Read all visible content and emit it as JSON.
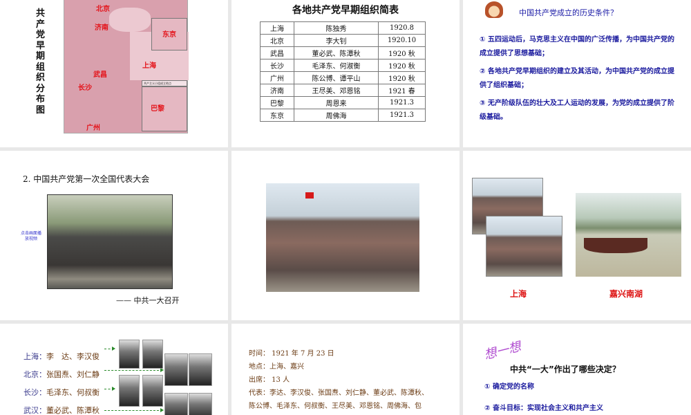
{
  "slide1": {
    "title": "共产党早期组织分布图",
    "map_labels": [
      "北京",
      "济南",
      "东京",
      "上海",
      "武昌",
      "长沙",
      "巴黎",
      "广州"
    ],
    "legend": "共产主义小组成立地点"
  },
  "slide2": {
    "title": "各地共产党早期组织简表",
    "rows": [
      [
        "上海",
        "陈独秀",
        "1920.8"
      ],
      [
        "北京",
        "李大钊",
        "1920.10"
      ],
      [
        "武昌",
        "董必武、陈潭秋",
        "1920 秋"
      ],
      [
        "长沙",
        "毛泽东、何淑衡",
        "1920 秋"
      ],
      [
        "广州",
        "陈公博、谭平山",
        "1920 秋"
      ],
      [
        "济南",
        "王尽美、邓恩铭",
        "1921 春"
      ],
      [
        "巴黎",
        "周恩来",
        "1921.3"
      ],
      [
        "东京",
        "周佛海",
        "1921.3"
      ]
    ]
  },
  "slide3": {
    "question": "中国共产党成立的历史条件？",
    "points": [
      "① 五四运动后，马克思主义在中国的广泛传播，为中国共产党的成立提供了思想基础；",
      "② 各地共产党早期组织的建立及其活动，为中国共产党的成立提供了组织基础；",
      "③ 无产阶级队伍的壮大及工人运动的发展，为党的成立提供了阶级基础。"
    ]
  },
  "slide4": {
    "heading": "2. 中国共产党第一次全国代表大会",
    "video_hint": "点击画面播放视频",
    "caption": "—— 中共一大召开"
  },
  "slide6": {
    "label_left": "上海",
    "label_right": "嘉兴南湖"
  },
  "slide7": {
    "delegates": [
      {
        "city": "上海：",
        "names": "李　达、李汉俊"
      },
      {
        "city": "北京：",
        "names": "张国焘、刘仁静"
      },
      {
        "city": "长沙：",
        "names": "毛泽东、何叔衡"
      },
      {
        "city": "武汉：",
        "names": "董必武、陈潭秋"
      }
    ]
  },
  "slide8": {
    "lines": [
      "时间： 1921 年 7 月 23 日",
      "地点：上海、嘉兴",
      "出席： 13 人",
      "代表：李达、李汉俊、张国焘、刘仁静、董必武、陈潭秋、",
      "陈公博、毛泽东、何叔衡、王尽美、邓恩铭、周佛海、包"
    ]
  },
  "slide9": {
    "think": "想一想",
    "question": "中共“一大”作出了哪些决定？",
    "points": [
      "① 确定党的名称",
      "② 奋斗目标：实现社会主义和共产主义"
    ]
  }
}
